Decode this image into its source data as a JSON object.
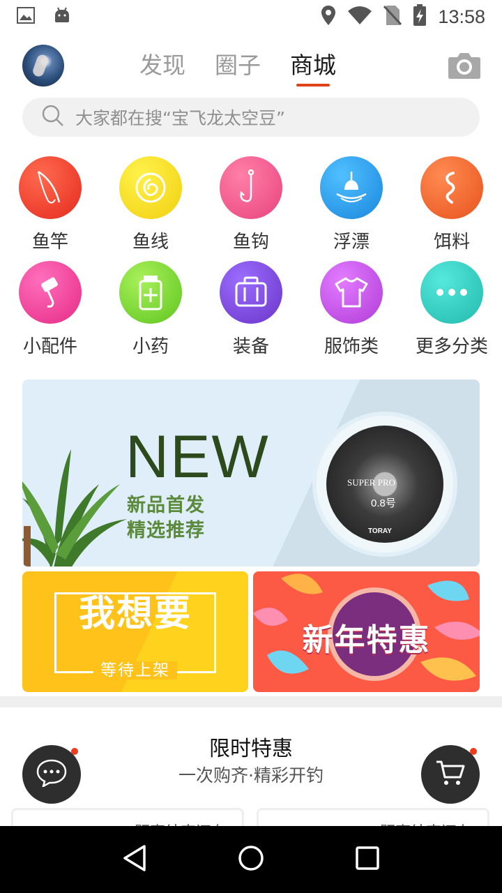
{
  "status_bar": {
    "time": "13:58",
    "icons": [
      "image-icon",
      "android-icon",
      "location-icon",
      "wifi-icon",
      "no-sim-icon",
      "battery-charging-icon"
    ]
  },
  "header": {
    "tabs": [
      {
        "label": "发现",
        "active": false
      },
      {
        "label": "圈子",
        "active": false
      },
      {
        "label": "商城",
        "active": true
      }
    ],
    "camera_icon": "camera-icon"
  },
  "search": {
    "placeholder": "大家都在搜“宝飞龙太空豆”"
  },
  "categories": [
    {
      "label": "鱼竿",
      "icon": "fishing-rod-icon",
      "color": "#f0412b"
    },
    {
      "label": "鱼线",
      "icon": "fishing-line-icon",
      "color": "#f6dc1f"
    },
    {
      "label": "鱼钩",
      "icon": "fish-hook-icon",
      "color": "#ef5b8c"
    },
    {
      "label": "浮漂",
      "icon": "float-icon",
      "color": "#2d9fe8"
    },
    {
      "label": "饵料",
      "icon": "bait-icon",
      "color": "#f26a2e"
    },
    {
      "label": "小配件",
      "icon": "accessory-icon",
      "color": "#f0479a"
    },
    {
      "label": "小药",
      "icon": "medicine-icon",
      "color": "#7fd636"
    },
    {
      "label": "装备",
      "icon": "luggage-icon",
      "color": "#7c4fd6"
    },
    {
      "label": "服饰类",
      "icon": "shirt-icon",
      "color": "#c046e0"
    },
    {
      "label": "更多分类",
      "icon": "more-icon",
      "color": "#33cfc4"
    }
  ],
  "banners": {
    "new": {
      "headline": "NEW",
      "line1": "新品首发",
      "line2": "精选推荐",
      "product_brand": "SUPER PRO",
      "product_gauge": "0.8号",
      "product_maker": "TORAY"
    },
    "want": {
      "title": "我想要",
      "subtitle": "等待上架"
    },
    "new_year": {
      "title": "新年特惠"
    }
  },
  "flash_sale": {
    "title": "限时特惠",
    "subtitle": "一次购齐·精彩开钓",
    "card_text": "距离结束还有"
  },
  "floating": {
    "chat_icon": "chat-icon",
    "cart_icon": "cart-icon"
  },
  "nav": {
    "back_icon": "back-icon",
    "home_icon": "home-icon",
    "recent_icon": "recent-apps-icon"
  }
}
